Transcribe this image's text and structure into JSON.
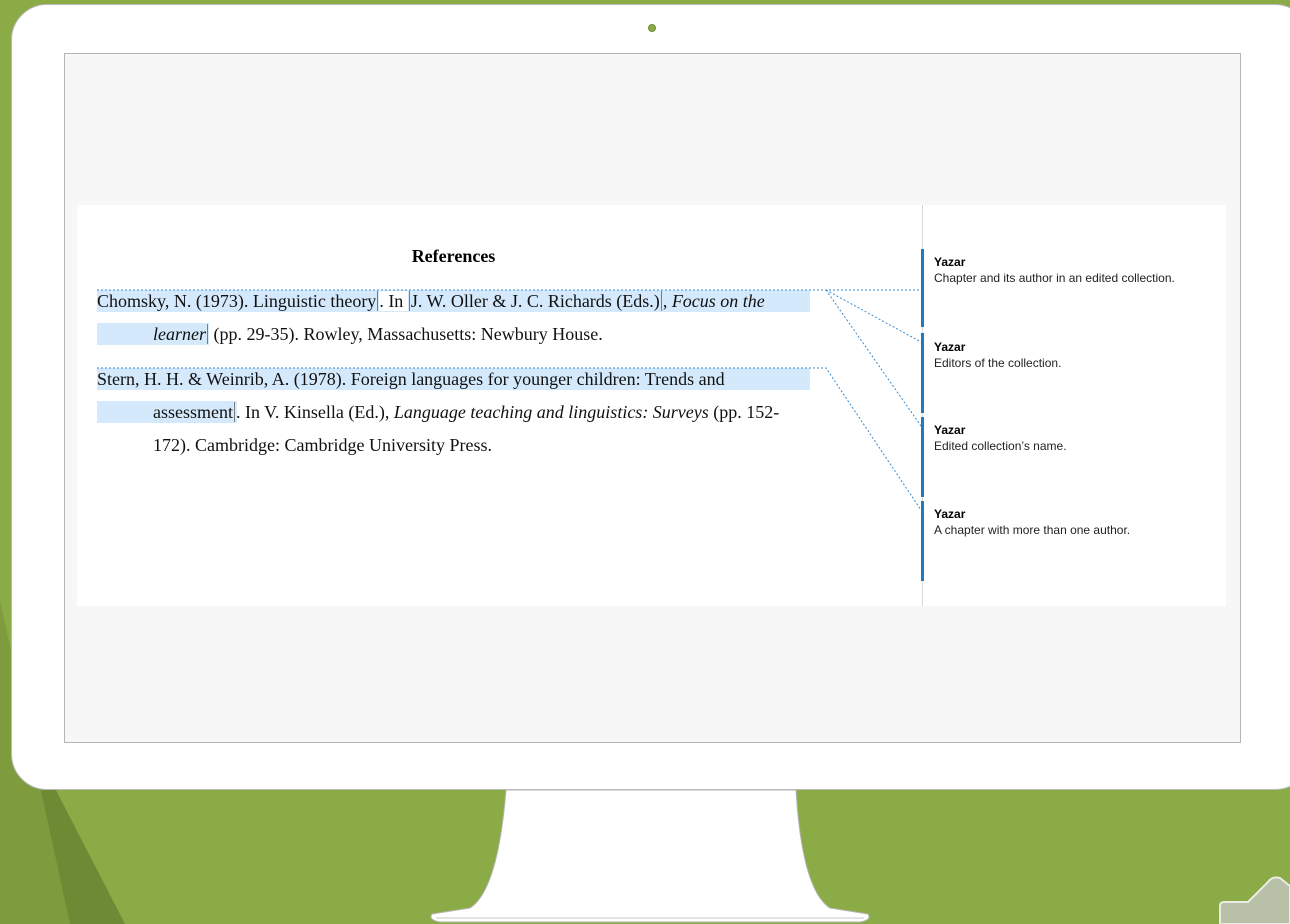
{
  "document": {
    "title": "References",
    "ref1": {
      "line1_part1": "Chomsky, N. (1973). Linguistic theory",
      "line1_part2": ". In ",
      "line1_part3": "J. W. Oller & J. C. Richards (Eds.)",
      "line1_part4": ", ",
      "line1_part5": "Focus on the",
      "line2_part1": "learner",
      "line2_part2": " (pp. 29-35). Rowley, Massachusetts: Newbury House."
    },
    "ref2": {
      "line1": "Stern, H. H. & Weinrib, A. (1978). Foreign languages for younger children: Trends and",
      "line2_part1": "assessment",
      "line2_part2": ". In V. Kinsella (Ed.), ",
      "line2_part3": "Language teaching and linguistics: Surveys",
      "line2_part4": " (pp. 152-",
      "line3": "172). Cambridge: Cambridge University Press."
    }
  },
  "comments": [
    {
      "author": "Yazar",
      "text": "Chapter and its author in an edited collection."
    },
    {
      "author": "Yazar",
      "text": "Editors of the collection."
    },
    {
      "author": "Yazar",
      "text": "Edited collection’s name."
    },
    {
      "author": "Yazar",
      "text": "A chapter with more than one author."
    }
  ],
  "colors": {
    "background": "#8aab45",
    "highlight": "#d4e9fb",
    "comment_accent": "#1f7bbd"
  }
}
